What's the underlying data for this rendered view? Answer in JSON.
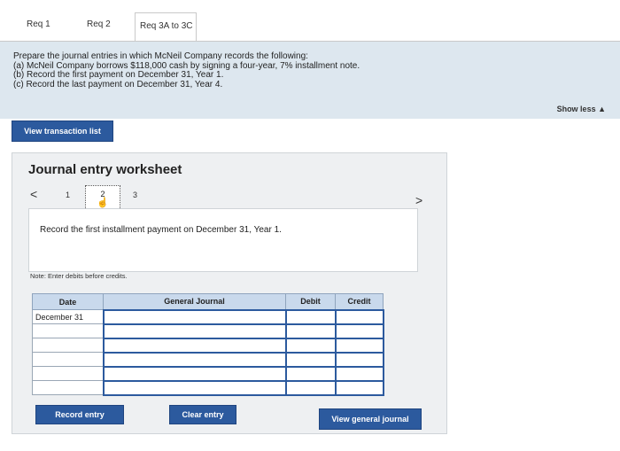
{
  "tabs": [
    {
      "label": "Req 1"
    },
    {
      "label": "Req 2"
    },
    {
      "label": "Req 3A to 3C"
    }
  ],
  "prompt": {
    "lines": [
      "Prepare the journal entries in which McNeil Company records the following:",
      "(a) McNeil Company borrows $118,000 cash by signing a four-year, 7% installment note.",
      "(b) Record the first payment on December 31, Year 1.",
      "(c) Record the last payment on December 31, Year 4."
    ]
  },
  "show_less_label": "Show less ▲",
  "view_transaction_label": "View transaction list",
  "worksheet": {
    "title": "Journal entry worksheet",
    "pager": {
      "prev": "<",
      "next": ">",
      "pages": [
        "1",
        "2",
        "3"
      ],
      "current": "2"
    },
    "task": "Record the first installment payment on December 31, Year 1.",
    "note": "Note: Enter debits before credits.",
    "table": {
      "headers": [
        "Date",
        "General Journal",
        "Debit",
        "Credit"
      ],
      "rows": [
        [
          "December 31",
          "",
          "",
          ""
        ],
        [
          "",
          "",
          "",
          ""
        ],
        [
          "",
          "",
          "",
          ""
        ],
        [
          "",
          "",
          "",
          ""
        ],
        [
          "",
          "",
          "",
          ""
        ],
        [
          "",
          "",
          "",
          ""
        ]
      ]
    },
    "buttons": {
      "record": "Record entry",
      "clear": "Clear entry",
      "view_journal": "View general journal"
    }
  }
}
